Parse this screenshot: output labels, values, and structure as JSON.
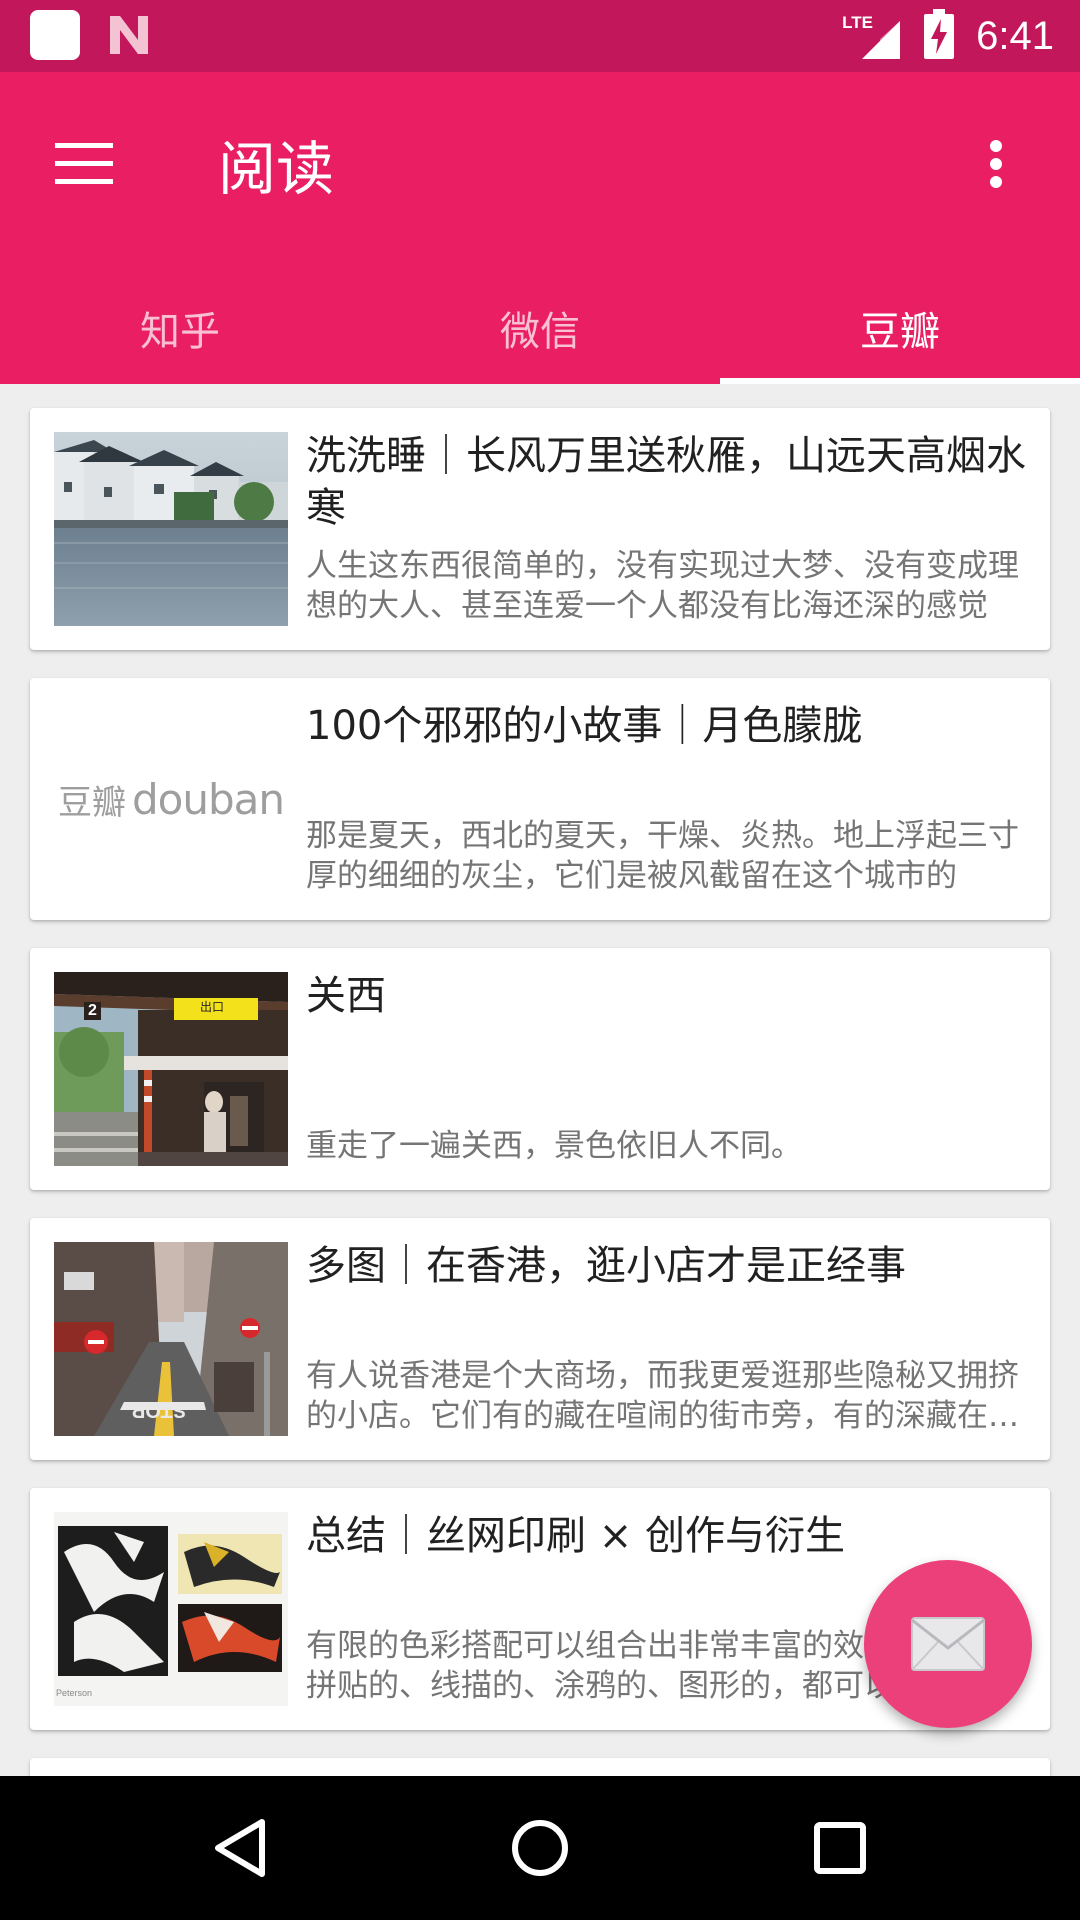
{
  "status_bar": {
    "time": "6:41",
    "network": "LTE",
    "icons": [
      "app-notification-icon",
      "n-notification-icon",
      "lte-signal-icon",
      "battery-charging-icon"
    ]
  },
  "app_bar": {
    "title": "阅读",
    "menu_icon": "hamburger-menu-icon",
    "overflow_icon": "more-vert-icon"
  },
  "tabs": [
    {
      "label": "知乎",
      "active": false
    },
    {
      "label": "微信",
      "active": false
    },
    {
      "label": "豆瓣",
      "active": true
    }
  ],
  "articles": [
    {
      "title": "洗洗睡｜长风万里送秋雁，山远天高烟水寒",
      "desc": "人生这东西很简单的，没有实现过大梦、没有变成理想的大人、甚至连爱一个人都没有比海还深的感觉",
      "thumb": "canal-town-photo"
    },
    {
      "title": "100个邪邪的小故事｜月色朦胧",
      "desc": "那是夏天，西北的夏天，干燥、炎热。地上浮起三寸厚的细细的灰尘，它们是被风截留在这个城市的",
      "thumb": "douban-logo",
      "logo_cn": "豆瓣",
      "logo_en": "douban"
    },
    {
      "title": "关西",
      "desc": "重走了一遍关西，景色依旧人不同。",
      "thumb": "train-station-photo",
      "sign_text": "出口",
      "platform_number": "2"
    },
    {
      "title": "多图｜在香港，逛小店才是正经事",
      "desc": "有人说香港是个大商场，而我更爱逛那些隐秘又拥挤的小店。它们有的藏在喧闹的街市旁，有的深藏在唐楼之中",
      "thumb": "hong-kong-street-photo",
      "road_text": "STOP"
    },
    {
      "title": "总结｜丝网印刷 × 创作与衍生",
      "desc": "有限的色彩搭配可以组合出非常丰富的效果，不管是拼贴的、线描的、涂鸦的、图形的，都可以",
      "thumb": "screen-print-artwork",
      "credit": "Peterson"
    }
  ],
  "fab": {
    "icon": "mail-icon"
  },
  "nav_bar": {
    "icons": [
      "back-icon",
      "home-icon",
      "recents-icon"
    ]
  },
  "colors": {
    "status_bar": "#c2185b",
    "primary": "#e91e63",
    "fab": "#ec407a",
    "background": "#eeeeee"
  }
}
